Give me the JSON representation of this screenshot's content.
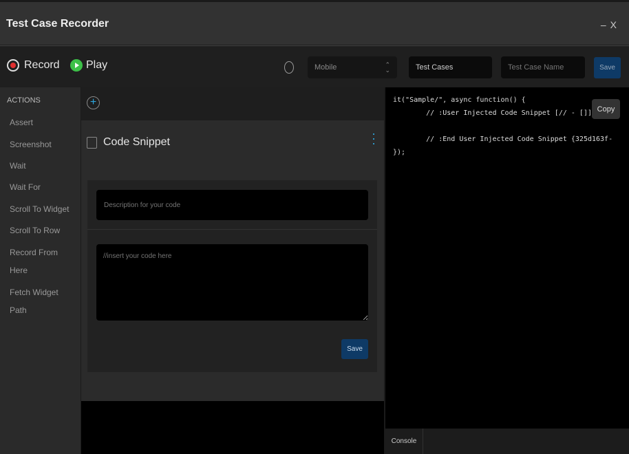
{
  "window": {
    "title": "Test Case Recorder",
    "minimize": "–",
    "close": "X"
  },
  "toolbar": {
    "record_label": "Record",
    "play_label": "Play",
    "device_select": "Mobile",
    "test_cases": "Test Cases",
    "test_case_name_placeholder": "Test Case Name",
    "save_label": "Save",
    "accent": "#0e3a66"
  },
  "sidebar": {
    "heading": "ACTIONS",
    "items": [
      {
        "label": "Assert"
      },
      {
        "label": "Screenshot"
      },
      {
        "label": "Wait"
      },
      {
        "label": "Wait For"
      },
      {
        "label": "Scroll To Widget"
      },
      {
        "label": "Scroll To Row"
      },
      {
        "label": "Record From Here"
      },
      {
        "label": "Fetch Widget Path"
      }
    ]
  },
  "snippet": {
    "title": "Code Snippet",
    "description_placeholder": "Description for your code",
    "code_placeholder": "//insert your code here",
    "save_label": "Save"
  },
  "code": {
    "lines": [
      "it(\"Sample/\", async function() {",
      "        // :User Injected Code Snippet [// - []]",
      "",
      "        // :End User Injected Code Snippet {325d163f-",
      "});"
    ],
    "copy_label": "Copy"
  },
  "console": {
    "tab_label": "Console"
  }
}
